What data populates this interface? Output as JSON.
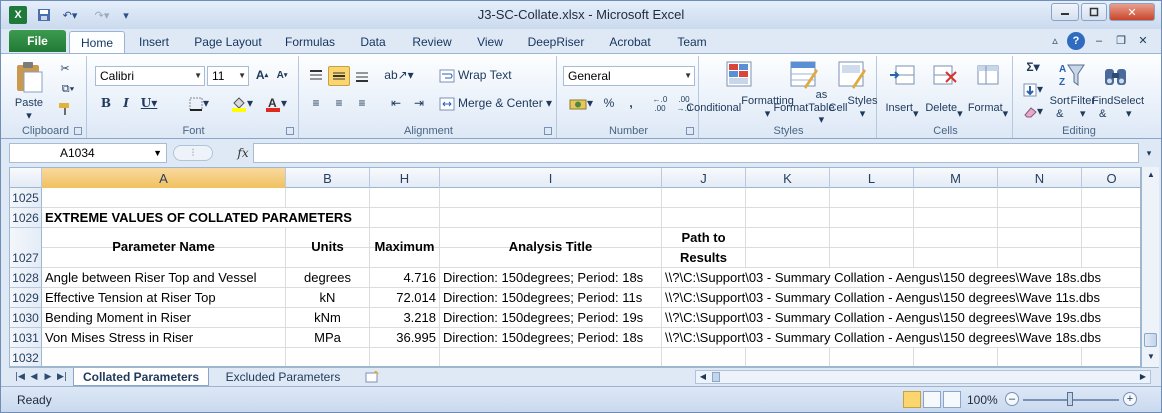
{
  "window": {
    "title": "J3-SC-Collate.xlsx  -  Microsoft Excel"
  },
  "ribbon_tabs": [
    "File",
    "Home",
    "Insert",
    "Page Layout",
    "Formulas",
    "Data",
    "Review",
    "View",
    "DeepRiser",
    "Acrobat",
    "Team"
  ],
  "font": {
    "name": "Calibri",
    "size": "11"
  },
  "number_format": "General",
  "groups": {
    "clipboard": "Clipboard",
    "font": "Font",
    "alignment": "Alignment",
    "number": "Number",
    "styles": "Styles",
    "cells": "Cells",
    "editing": "Editing"
  },
  "buttons": {
    "paste": "Paste",
    "wrap_text": "Wrap Text",
    "merge_center": "Merge & Center",
    "conditional_formatting": [
      "Conditional",
      "Formatting ▾"
    ],
    "format_as_table": [
      "Format",
      "as Table ▾"
    ],
    "cell_styles": [
      "Cell",
      "Styles ▾"
    ],
    "insert": "Insert",
    "delete": "Delete",
    "format": "Format",
    "sort_filter": [
      "Sort &",
      "Filter ▾"
    ],
    "find_select": [
      "Find &",
      "Select ▾"
    ]
  },
  "name_box": "A1034",
  "fx": "fx",
  "columns": [
    "A",
    "B",
    "H",
    "I",
    "J",
    "K",
    "L",
    "M",
    "N",
    "O"
  ],
  "rows": {
    "r1025": "1025",
    "r1026": "1026",
    "r1027": "1027",
    "r1028": "1028",
    "r1029": "1029",
    "r1030": "1030",
    "r1031": "1031",
    "r1032": "1032"
  },
  "cells": {
    "heading": "EXTREME VALUES OF COLLATED PARAMETERS",
    "headers": {
      "parameter": "Parameter Name",
      "units": "Units",
      "maximum": "Maximum",
      "analysis": "Analysis Title",
      "path1": "Path to",
      "path2": "Results"
    },
    "data": [
      {
        "param": "Angle between Riser Top and Vessel",
        "units": "degrees",
        "max": "4.716",
        "analysis": "Direction: 150degrees; Period: 18s",
        "path": "\\\\?\\C:\\Support\\03 - Summary Collation - Aengus\\150 degrees\\Wave 18s.dbs"
      },
      {
        "param": "Effective Tension at Riser Top",
        "units": "kN",
        "max": "72.014",
        "analysis": "Direction: 150degrees; Period: 11s",
        "path": "\\\\?\\C:\\Support\\03 - Summary Collation - Aengus\\150 degrees\\Wave 11s.dbs"
      },
      {
        "param": "Bending Moment in Riser",
        "units": "kNm",
        "max": "3.218",
        "analysis": "Direction: 150degrees; Period: 19s",
        "path": "\\\\?\\C:\\Support\\03 - Summary Collation - Aengus\\150 degrees\\Wave 19s.dbs"
      },
      {
        "param": "Von Mises Stress in Riser",
        "units": "MPa",
        "max": "36.995",
        "analysis": "Direction: 150degrees; Period: 18s",
        "path": "\\\\?\\C:\\Support\\03 - Summary Collation - Aengus\\150 degrees\\Wave 18s.dbs"
      }
    ]
  },
  "sheets": [
    "Collated Parameters",
    "Excluded Parameters"
  ],
  "status": "Ready",
  "zoom": "100%"
}
